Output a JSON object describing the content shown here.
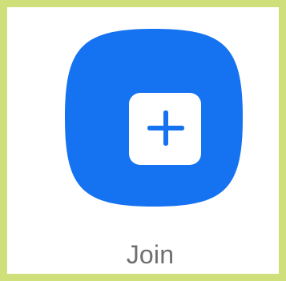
{
  "button": {
    "label": "Join",
    "icon": "plus-icon"
  },
  "colors": {
    "frame_border": "#cfe07a",
    "tile_background": "#1572f0",
    "icon_background": "#ffffff",
    "icon_glyph": "#1572f0",
    "label_text": "#6f6f6f"
  }
}
